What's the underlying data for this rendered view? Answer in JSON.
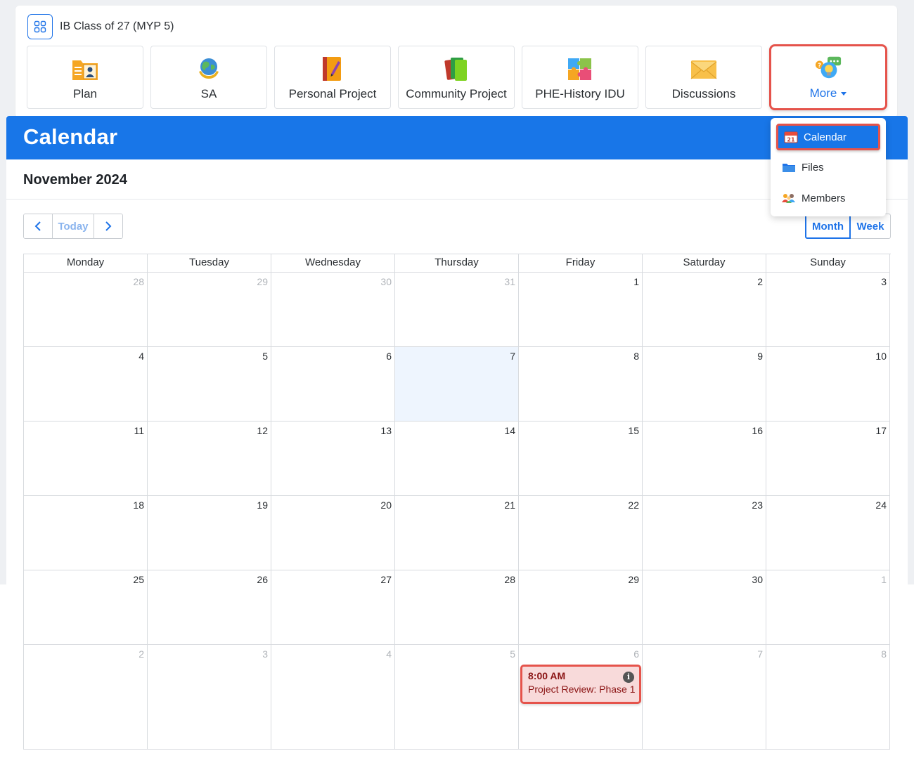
{
  "class": {
    "title": "IB Class of 27 (MYP 5)"
  },
  "tabs": [
    {
      "label": "Plan",
      "icon": "plan-icon"
    },
    {
      "label": "SA",
      "icon": "globe-icon"
    },
    {
      "label": "Personal Project",
      "icon": "notebook-icon"
    },
    {
      "label": "Community Project",
      "icon": "books-icon"
    },
    {
      "label": "PHE-History IDU",
      "icon": "puzzle-icon"
    },
    {
      "label": "Discussions",
      "icon": "envelope-icon"
    },
    {
      "label": "More",
      "icon": "ideas-icon"
    }
  ],
  "dropdown": {
    "items": [
      {
        "label": "Calendar",
        "icon": "calendar-icon",
        "badge": "21"
      },
      {
        "label": "Files",
        "icon": "folder-icon"
      },
      {
        "label": "Members",
        "icon": "members-icon"
      }
    ]
  },
  "calendar": {
    "heading": "Calendar",
    "month_title": "November 2024",
    "today_label": "Today",
    "views": {
      "month": "Month",
      "week": "Week"
    },
    "daynames": [
      "Monday",
      "Tuesday",
      "Wednesday",
      "Thursday",
      "Friday",
      "Saturday",
      "Sunday"
    ],
    "weeks": [
      [
        "28",
        "29",
        "30",
        "31",
        "1",
        "2",
        "3"
      ],
      [
        "4",
        "5",
        "6",
        "7",
        "8",
        "9",
        "10"
      ],
      [
        "11",
        "12",
        "13",
        "14",
        "15",
        "16",
        "17"
      ],
      [
        "18",
        "19",
        "20",
        "21",
        "22",
        "23",
        "24"
      ],
      [
        "25",
        "26",
        "27",
        "28",
        "29",
        "30",
        "1"
      ],
      [
        "2",
        "3",
        "4",
        "5",
        "6",
        "7",
        "8"
      ]
    ],
    "event": {
      "time": "8:00 AM",
      "title": "Project Review: Phase 1",
      "info": "i"
    }
  },
  "colors": {
    "accent": "#1876e8",
    "highlight": "#e5534b",
    "event_bg": "#f8dada",
    "event_text": "#8b1414"
  }
}
